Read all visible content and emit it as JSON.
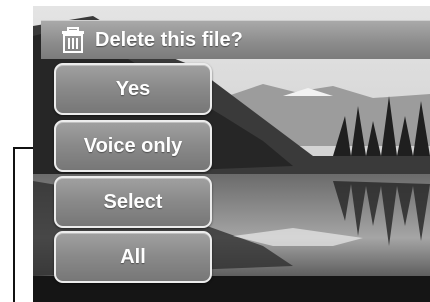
{
  "dialog": {
    "title": "Delete this file?",
    "icon": "trash-icon"
  },
  "menu": {
    "items": [
      {
        "label": "Yes"
      },
      {
        "label": "Voice only"
      },
      {
        "label": "Select"
      },
      {
        "label": "All"
      }
    ]
  },
  "colors": {
    "title_bar": "#8d8d8d",
    "button_fill": "#898989",
    "button_border": "#ececec",
    "text": "#ffffff"
  }
}
